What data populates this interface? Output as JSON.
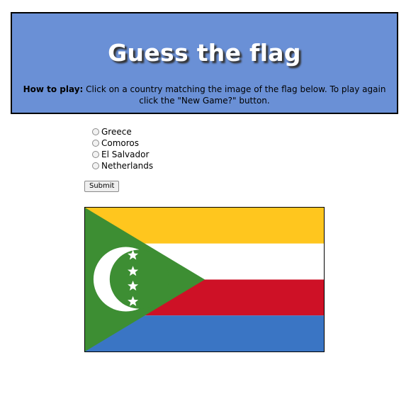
{
  "header": {
    "title": "Guess the flag",
    "instructions_label": "How to play:",
    "instructions_text": "Click on a country matching the image of the flag below. To play again click the \"New Game?\" button."
  },
  "options": [
    {
      "label": "Greece"
    },
    {
      "label": "Comoros"
    },
    {
      "label": "El Salvador"
    },
    {
      "label": "Netherlands"
    }
  ],
  "submit_label": "Submit",
  "flag": {
    "name": "flag-image-comoros",
    "colors": {
      "yellow": "#ffc61e",
      "white": "#ffffff",
      "red": "#ce1126",
      "blue": "#3a75c4",
      "green": "#3d8e33"
    }
  }
}
